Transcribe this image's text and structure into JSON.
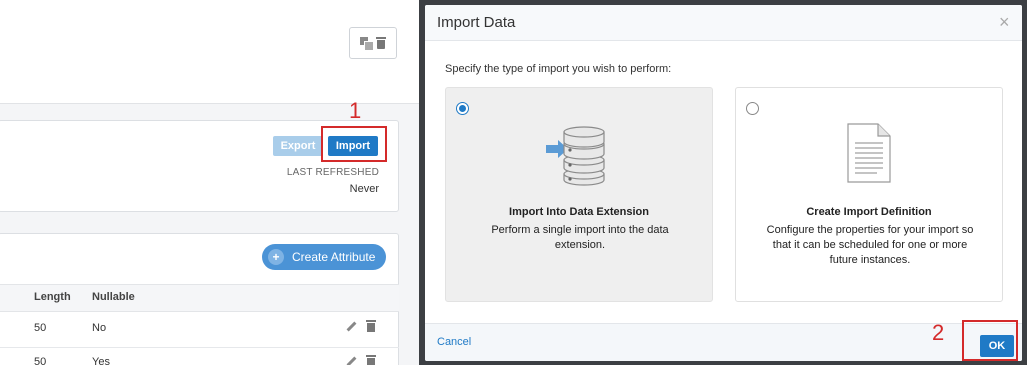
{
  "background": {
    "import_panel": {
      "export_label": "Export",
      "import_label": "Import",
      "last_refreshed_label": "LAST REFRESHED",
      "last_refreshed_value": "Never"
    },
    "attributes": {
      "create_label": "Create Attribute",
      "columns": [
        "Length",
        "Nullable"
      ],
      "rows": [
        {
          "length": "50",
          "nullable": "No"
        },
        {
          "length": "50",
          "nullable": "Yes"
        }
      ]
    }
  },
  "annotations": {
    "step1": "1",
    "step2": "2",
    "color": "#d42a2a"
  },
  "dialog": {
    "title": "Import Data",
    "close": "×",
    "prompt": "Specify the type of import you wish to perform:",
    "options": [
      {
        "title": "Import Into Data Extension",
        "description": "Perform a single import into the data extension.",
        "selected": true,
        "icon": "database-import-icon"
      },
      {
        "title": "Create Import Definition",
        "description": "Configure the properties for your import so that it can be scheduled for one or more future instances.",
        "selected": false,
        "icon": "document-icon"
      }
    ],
    "cancel_label": "Cancel",
    "ok_label": "OK"
  },
  "colors": {
    "accent": "#1f7ac6",
    "export_disabled": "#a9cdea",
    "create_button": "#4b93d6"
  }
}
